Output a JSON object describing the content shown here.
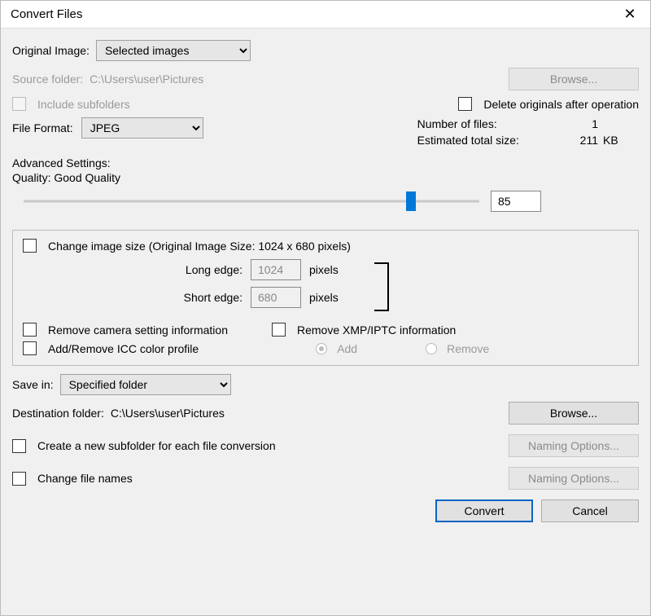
{
  "window": {
    "title": "Convert Files",
    "close_glyph": "✕"
  },
  "original": {
    "label": "Original Image:",
    "selected": "Selected images"
  },
  "source": {
    "label": "Source folder:",
    "path": "C:\\Users\\user\\Pictures",
    "browse": "Browse..."
  },
  "include_subfolders": "Include subfolders",
  "delete_originals": "Delete originals after operation",
  "format": {
    "label": "File Format:",
    "selected": "JPEG"
  },
  "stats": {
    "files_label": "Number of files:",
    "files_value": "1",
    "size_label": "Estimated total size:",
    "size_value": "211",
    "size_unit": "KB"
  },
  "advanced": {
    "heading": "Advanced Settings:",
    "quality_label": "Quality: Good Quality",
    "quality_value": "85",
    "quality_percent": 85
  },
  "size_box": {
    "change_label": "Change image size (Original Image Size: 1024 x 680 pixels)",
    "long_label": "Long edge:",
    "long_value": "1024",
    "short_label": "Short edge:",
    "short_value": "680",
    "unit": "pixels",
    "remove_camera": "Remove camera setting information",
    "remove_xmp": "Remove XMP/IPTC information",
    "icc_label": "Add/Remove ICC color profile",
    "icc_add": "Add",
    "icc_remove": "Remove"
  },
  "save": {
    "label": "Save in:",
    "selected": "Specified folder",
    "dest_label": "Destination folder:",
    "dest_path": "C:\\Users\\user\\Pictures",
    "browse": "Browse...",
    "subfolder_label": "Create a new subfolder for each file conversion",
    "naming_opts": "Naming Options...",
    "change_names": "Change file names"
  },
  "footer": {
    "convert": "Convert",
    "cancel": "Cancel"
  }
}
